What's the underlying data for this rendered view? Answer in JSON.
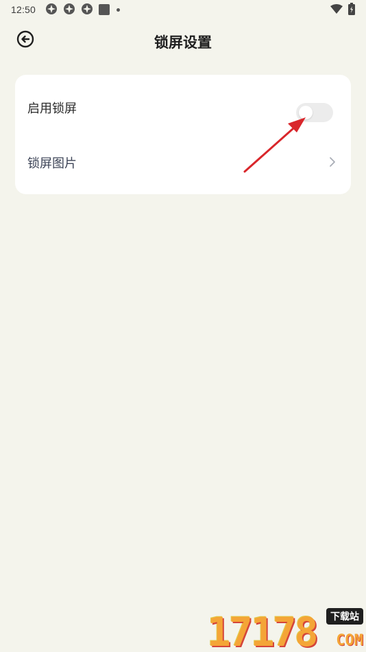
{
  "status_bar": {
    "time": "12:50",
    "icons": [
      "app-notification-icon",
      "app-notification-icon",
      "app-notification-icon",
      "square-notification-icon",
      "dot-icon"
    ],
    "right_icons": [
      "wifi-icon",
      "battery-icon"
    ]
  },
  "header": {
    "back_icon": "back-arrow-circle-icon",
    "title": "锁屏设置"
  },
  "settings": {
    "enable_lock": {
      "label": "启用锁屏",
      "enabled": false
    },
    "lock_image": {
      "label": "锁屏图片",
      "icon": "chevron-right-icon"
    }
  },
  "annotation": {
    "color": "#d9262b"
  },
  "watermark": {
    "digits": "17178",
    "tag": "下载站",
    "suffix": "COM"
  },
  "colors": {
    "background": "#f4f4ec",
    "card": "#ffffff",
    "toggle_off": "#ececec"
  }
}
